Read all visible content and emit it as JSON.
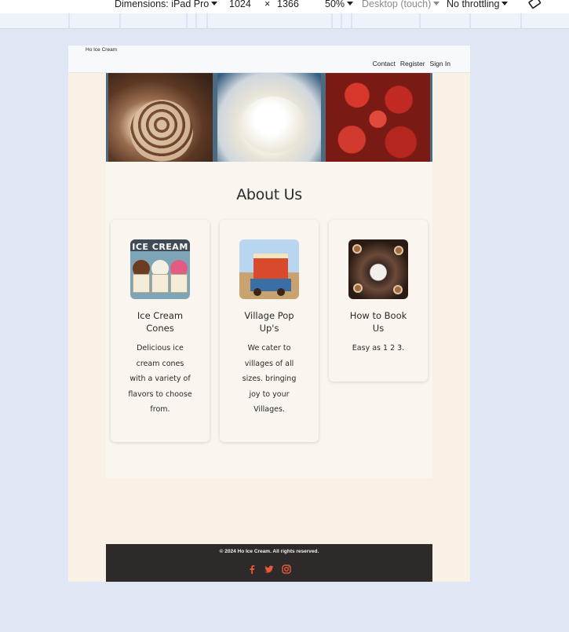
{
  "devtools": {
    "dimensions_label": "Dimensions: iPad Pro",
    "width": "1024",
    "times": "×",
    "height": "1366",
    "zoom": "50%",
    "device_type": "Desktop (touch)",
    "throttling": "No throttling"
  },
  "site": {
    "brand": "Ho Ice Cream",
    "nav": [
      "Contact",
      "Register",
      "Sign In"
    ],
    "hero_alt": [
      "chocolate ice cream tub",
      "vanilla ice cream tub",
      "strawberries tub"
    ],
    "about_title": "About Us",
    "cards": [
      {
        "image_sign": "ICE CREAM",
        "title": "Ice Cream Cones",
        "text": "Delicious ice cream cones with a variety of flavors to choose from."
      },
      {
        "title": "Village Pop Up's",
        "text": "We cater to villages of all sizes. bringing joy to your Villages."
      },
      {
        "title": "How to Book Us",
        "text": "Easy as 1 2 3."
      }
    ],
    "footer_copy": "© 2024 Ho Ice Cream. All rights reserved.",
    "socials": [
      "facebook-icon",
      "twitter-icon",
      "instagram-icon"
    ],
    "colors": {
      "page_bg": "#f9f0e6",
      "footer_bg": "#2f2a2a",
      "social_accent": "#e8583a"
    }
  }
}
